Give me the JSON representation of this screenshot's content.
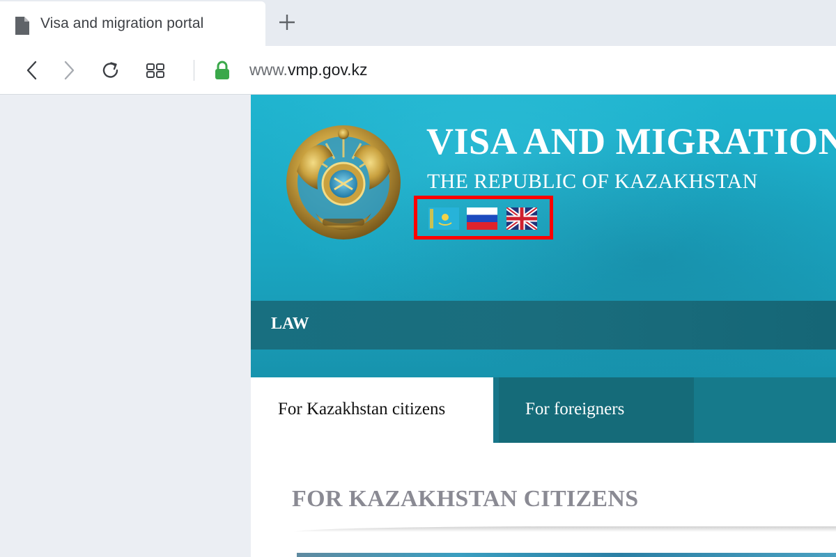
{
  "browser": {
    "tab": {
      "title": "Visa and migration portal",
      "icon": "document-icon"
    },
    "new_tab_icon": "plus-icon",
    "toolbar": {
      "back_icon": "chevron-left-icon",
      "forward_icon": "chevron-right-icon",
      "reload_icon": "reload-icon",
      "tabs_overview_icon": "grid-icon",
      "lock_icon": "lock-icon",
      "url_prefix": "www.",
      "url_host": "vmp.gov.kz"
    }
  },
  "site": {
    "title": "VISA AND MIGRATION",
    "subtitle": "THE REPUBLIC OF KAZAKHSTAN",
    "emblem_icon": "kazakhstan-emblem-icon",
    "languages": [
      {
        "code": "kz",
        "icon": "kazakhstan-flag-icon"
      },
      {
        "code": "ru",
        "icon": "russia-flag-icon"
      },
      {
        "code": "en",
        "icon": "uk-flag-icon"
      }
    ],
    "nav": {
      "law": "LAW"
    },
    "tabs": [
      {
        "label": "For Kazakhstan citizens",
        "active": true
      },
      {
        "label": "For foreigners",
        "active": false
      }
    ],
    "section_heading": "FOR KAZAKHSTAN CITIZENS",
    "colors": {
      "banner": "#1fb4cf",
      "nav": "#186f80",
      "highlight_box": "#ff0000",
      "heading": "#8a8a93"
    }
  }
}
